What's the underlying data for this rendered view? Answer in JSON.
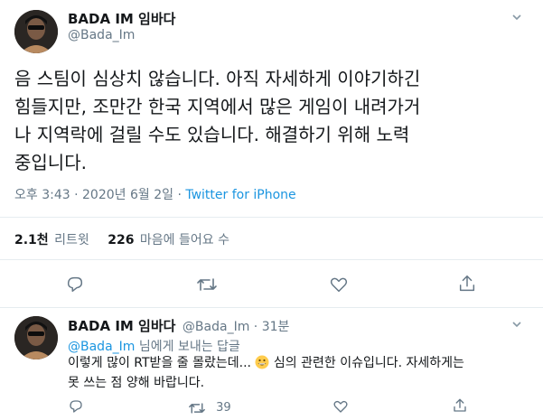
{
  "tweet": {
    "author_name": "BADA IM 임바다",
    "handle": "@Bada_Im",
    "text_lines": [
      "음 스팀이 심상치 않습니다. 아직 자세하게 이야기하긴",
      "힘들지만, 조만간 한국 지역에서 많은 게임이 내려가거",
      "나 지역락에 걸릴 수도 있습니다. 해결하기 위해 노력",
      "중입니다."
    ],
    "timestamp": "오후 3:43 · 2020년 6월 2일",
    "separator": "·",
    "source": "Twitter for iPhone",
    "retweets_count": "2.1천",
    "retweets_label": "리트윗",
    "likes_count": "226",
    "likes_label": "마음에 들어요 수"
  },
  "reply": {
    "author_name": "BADA IM 임바다",
    "handle": "@Bada_Im",
    "time": "· 31분",
    "replying_handle": "@Bada_Im",
    "replying_suffix": "님에게 보내는 답글",
    "text_line1_a": "이렇게 많이 RT받을 줄 몰랐는데...",
    "text_line1_b": "심의 관련한 이슈입니다. 자세하게는",
    "text_line2": "못 쓰는 점 양해 바랍니다.",
    "retweet_count": "39"
  },
  "icons": [
    "chevron-down-icon",
    "reply-icon",
    "retweet-icon",
    "like-icon",
    "share-icon",
    "grinning-emoji-icon"
  ],
  "colors": {
    "link": "#1b95e0",
    "muted": "#657786",
    "divider": "#e6ecf0",
    "text": "#14171a"
  }
}
